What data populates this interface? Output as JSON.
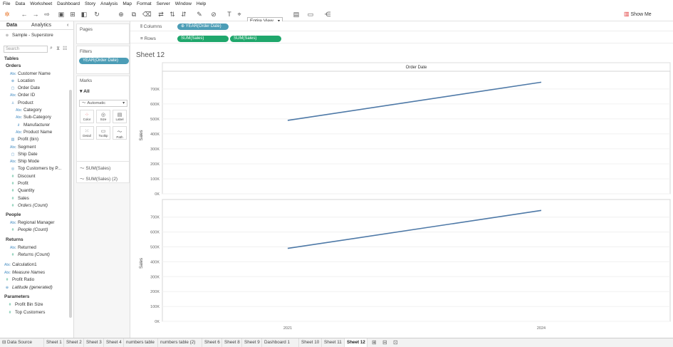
{
  "menu": [
    "File",
    "Data",
    "Worksheet",
    "Dashboard",
    "Story",
    "Analysis",
    "Map",
    "Format",
    "Server",
    "Window",
    "Help"
  ],
  "toolbar": {
    "fit": "Entire View",
    "show_me": "Show Me"
  },
  "left": {
    "tab_data": "Data",
    "tab_analytics": "Analytics",
    "datasource": "Sample - Superstore",
    "search_placeholder": "Search",
    "tables_label": "Tables",
    "orders": {
      "label": "Orders",
      "fields": [
        {
          "n": "Customer Name",
          "t": "Abc"
        },
        {
          "n": "Location",
          "t": "geo"
        },
        {
          "n": "Order Date",
          "t": "date"
        },
        {
          "n": "Order ID",
          "t": "Abc"
        },
        {
          "n": "Product",
          "t": "hier"
        },
        {
          "n": "Category",
          "t": "Abc"
        },
        {
          "n": "Sub-Category",
          "t": "Abc"
        },
        {
          "n": "Manufacturer",
          "t": "link"
        },
        {
          "n": "Product Name",
          "t": "Abc"
        },
        {
          "n": "Profit (bin)",
          "t": "bin"
        },
        {
          "n": "Segment",
          "t": "Abc"
        },
        {
          "n": "Ship Date",
          "t": "date"
        },
        {
          "n": "Ship Mode",
          "t": "Abc"
        },
        {
          "n": "Top Customers by P...",
          "t": "set"
        },
        {
          "n": "Discount",
          "t": "#"
        },
        {
          "n": "Profit",
          "t": "#"
        },
        {
          "n": "Quantity",
          "t": "#"
        },
        {
          "n": "Sales",
          "t": "#"
        },
        {
          "n": "Orders (Count)",
          "t": "#"
        }
      ]
    },
    "people": {
      "label": "People",
      "fields": [
        {
          "n": "Regional Manager",
          "t": "Abc"
        },
        {
          "n": "People (Count)",
          "t": "#"
        }
      ]
    },
    "returns": {
      "label": "Returns",
      "fields": [
        {
          "n": "Returned",
          "t": "Abc"
        },
        {
          "n": "Returns (Count)",
          "t": "#"
        }
      ]
    },
    "extra": [
      {
        "n": "Calculation1",
        "t": "Abc"
      },
      {
        "n": "Measure Names",
        "t": "Abc"
      },
      {
        "n": "Profit Ratio",
        "t": "#"
      },
      {
        "n": "Latitude (generated)",
        "t": "geo"
      }
    ],
    "parameters_label": "Parameters",
    "parameters": [
      {
        "n": "Profit Bin Size",
        "t": "#"
      },
      {
        "n": "Top Customers",
        "t": "#"
      }
    ]
  },
  "mid": {
    "pages": "Pages",
    "filters": "Filters",
    "filter_pill": "YEAR(Order Date)",
    "marks": "Marks",
    "all": "All",
    "mark_type": "Automatic",
    "buttons": [
      "Color",
      "Size",
      "Label",
      "Detail",
      "Tooltip",
      "Path"
    ],
    "mark_cards": [
      "SUM(Sales)",
      "SUM(Sales) (2)"
    ]
  },
  "shelves": {
    "columns_label": "Columns",
    "columns_pill": "YEAR(Order Date)",
    "rows_label": "Rows",
    "rows_pills": [
      "SUM(Sales)",
      "SUM(Sales)"
    ]
  },
  "sheet_title": "Sheet 12",
  "chart_data": [
    {
      "type": "line",
      "title": "",
      "xlabel": "Order Date",
      "ylabel": "Sales",
      "x": [
        "2021",
        "2024"
      ],
      "series": [
        {
          "values": [
            490000,
            745000
          ]
        }
      ],
      "ylim": [
        0,
        780000
      ],
      "yticks": [
        "0K",
        "100K",
        "200K",
        "300K",
        "400K",
        "500K",
        "600K",
        "700K"
      ],
      "line_color": "#4e79a7"
    },
    {
      "type": "line",
      "title": "",
      "xlabel": "",
      "ylabel": "Sales",
      "x": [
        "2021",
        "2024"
      ],
      "series": [
        {
          "values": [
            490000,
            745000
          ]
        }
      ],
      "ylim": [
        0,
        780000
      ],
      "yticks": [
        "0K",
        "100K",
        "200K",
        "300K",
        "400K",
        "500K",
        "600K",
        "700K"
      ],
      "line_color": "#4e79a7"
    }
  ],
  "tabs": [
    "Data Source",
    "Sheet 1",
    "Sheet 2",
    "Sheet 3",
    "Sheet 4",
    "numbers table",
    "numbers table (2)",
    "Sheet 6",
    "Sheet 8",
    "Sheet 9",
    "Dashboard 1",
    "Sheet 10",
    "Sheet 11",
    "Sheet 12"
  ],
  "active_tab": "Sheet 12"
}
